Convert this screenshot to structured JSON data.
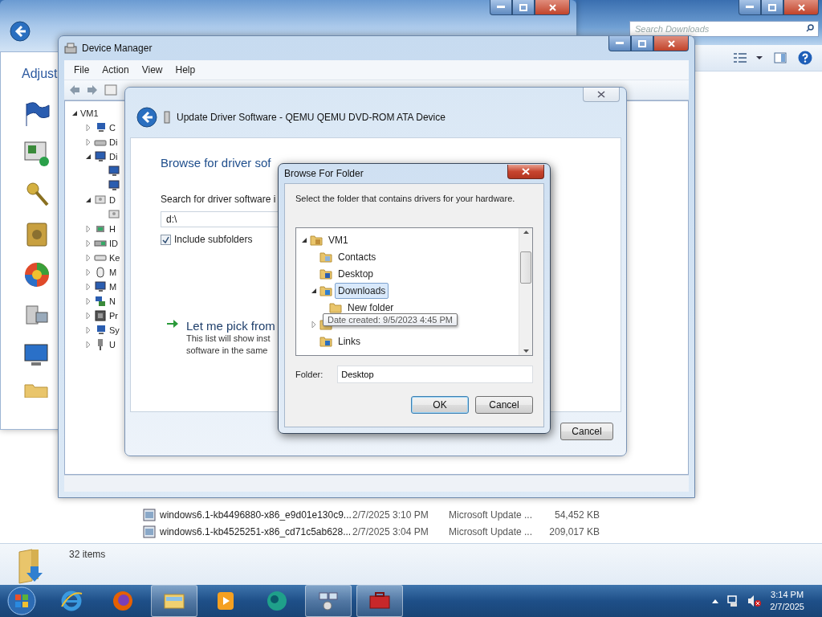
{
  "explorer": {
    "search": {
      "placeholder": "Search Downloads"
    },
    "files": [
      {
        "name": "windows6.1-kb4496880-x86_e9d01e130c9...",
        "date": "2/7/2025 3:10 PM",
        "type": "Microsoft Update ...",
        "size": "54,452 KB"
      },
      {
        "name": "windows6.1-kb4525251-x86_cd71c5ab628...",
        "date": "2/7/2025 3:04 PM",
        "type": "Microsoft Update ...",
        "size": "209,017 KB"
      }
    ],
    "status": "32 items"
  },
  "control_panel": {
    "heading": "Adjust"
  },
  "device_manager": {
    "title": "Device Manager",
    "menu": [
      "File",
      "Action",
      "View",
      "Help"
    ],
    "tree": {
      "label": "VM1",
      "expanded": true,
      "children": [
        {
          "label": "C",
          "kind": "computer",
          "expanded": false
        },
        {
          "label": "Di",
          "kind": "drive",
          "expanded": false
        },
        {
          "label": "Di",
          "kind": "monitor",
          "expanded": true,
          "children": [
            {
              "kind": "monitor"
            },
            {
              "kind": "monitor"
            }
          ]
        },
        {
          "label": "D",
          "kind": "dvd",
          "expanded": true,
          "children": [
            {
              "kind": "dvd"
            }
          ]
        },
        {
          "label": "H",
          "kind": "hid",
          "expanded": false
        },
        {
          "label": "ID",
          "kind": "ide",
          "expanded": false
        },
        {
          "label": "Ke",
          "kind": "keyboard",
          "expanded": false
        },
        {
          "label": "M",
          "kind": "mouse",
          "expanded": false
        },
        {
          "label": "M",
          "kind": "monitor",
          "expanded": false
        },
        {
          "label": "N",
          "kind": "network",
          "expanded": false
        },
        {
          "label": "Pr",
          "kind": "chip",
          "expanded": false
        },
        {
          "label": "Sy",
          "kind": "computer",
          "expanded": false
        },
        {
          "label": "U",
          "kind": "plug",
          "expanded": false
        }
      ]
    }
  },
  "update_driver": {
    "title": "Update Driver Software - QEMU QEMU DVD-ROM ATA Device",
    "heading": "Browse for driver sof",
    "search_label": "Search for driver software i",
    "path": "d:\\",
    "include_subfolders": {
      "label": "Include subfolders",
      "checked": true
    },
    "pick": {
      "title": "Let me pick from",
      "lines": [
        "This list will show inst",
        "software in the same"
      ]
    },
    "buttons": [
      "Cancel"
    ]
  },
  "browse_folder": {
    "title": "Browse For Folder",
    "instruction": "Select the folder that contains drivers for your hardware.",
    "tree": [
      {
        "label": "VM1",
        "kind": "user",
        "expanded": true,
        "hovered": false,
        "children": [
          {
            "label": "Contacts",
            "kind": "contacts",
            "hovered": false
          },
          {
            "label": "Desktop",
            "kind": "desktop",
            "hovered": false
          },
          {
            "label": "Downloads",
            "kind": "downloads",
            "expanded": true,
            "hovered": true,
            "children": [
              {
                "label": "New folder",
                "kind": "folder",
                "hovered": false
              }
            ]
          },
          {
            "kind": "folder",
            "expanded": false
          },
          {
            "label": "Links",
            "kind": "links",
            "hovered": false
          }
        ]
      }
    ],
    "tooltip": "Date created: 9/5/2023 4:45 PM",
    "folder_label": "Folder:",
    "folder_value": "Desktop",
    "buttons": [
      {
        "label": "OK",
        "default": true
      },
      {
        "label": "Cancel",
        "default": false
      }
    ]
  },
  "taskbar": {
    "apps": [
      {
        "kind": "ie",
        "active": false
      },
      {
        "kind": "firefox",
        "active": false
      },
      {
        "kind": "explorer",
        "active": true
      },
      {
        "kind": "media",
        "active": false
      },
      {
        "kind": "app",
        "active": false
      },
      {
        "kind": "devices",
        "active": true
      },
      {
        "kind": "toolbox",
        "active": true
      }
    ],
    "clock": {
      "time": "3:14 PM",
      "date": "2/7/2025"
    }
  }
}
